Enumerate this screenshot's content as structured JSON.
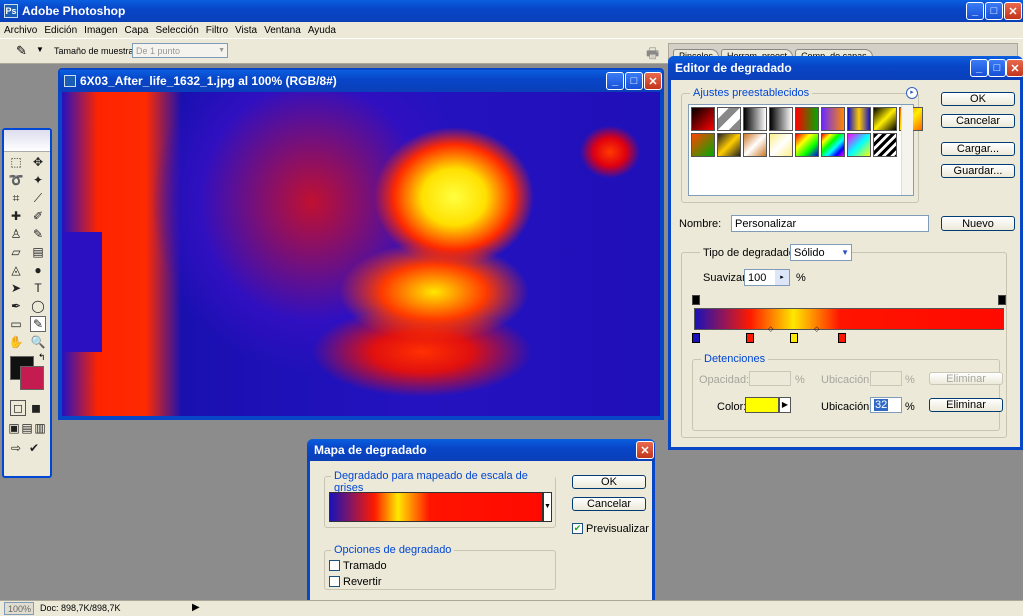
{
  "app": {
    "title": "Adobe Photoshop"
  },
  "menu": [
    "Archivo",
    "Edición",
    "Imagen",
    "Capa",
    "Selección",
    "Filtro",
    "Vista",
    "Ventana",
    "Ayuda"
  ],
  "options_bar": {
    "sample_label": "Tamaño de muestra:",
    "sample_value": "De 1 punto"
  },
  "palette_tabs": [
    "Pinceles",
    "Herram. preest",
    "Comp. de capas"
  ],
  "document": {
    "title": "6X03_After_life_1632_1.jpg al 100% (RGB/8#)"
  },
  "gradient_editor": {
    "title": "Editor de degradado",
    "presets_label": "Ajustes preestablecidos",
    "ok": "OK",
    "cancel": "Cancelar",
    "load": "Cargar...",
    "save": "Guardar...",
    "name_label": "Nombre:",
    "name_value": "Personalizar",
    "new": "Nuevo",
    "type_label": "Tipo de degradado:",
    "type_value": "Sólido",
    "smooth_label": "Suavizar:",
    "smooth_value": "100",
    "percent": "%",
    "stops_label": "Detenciones",
    "opacity_label": "Opacidad:",
    "location_label": "Ubicación:",
    "delete": "Eliminar",
    "color_label": "Color:",
    "location2_label": "Ubicación:",
    "location2_value": "32",
    "delete2": "Eliminar",
    "preset_swatches": [
      "linear-gradient(135deg,#000,#ff0000)",
      "linear-gradient(135deg,#fff 25%,#888 25%,#888 50%,#fff 50%,#fff 75%,#888 75%)",
      "linear-gradient(90deg,#000,#fff)",
      "linear-gradient(90deg,#000,#fff)",
      "linear-gradient(90deg,#ff0000,#00aa00)",
      "linear-gradient(90deg,#6a2cff,#ff8800)",
      "linear-gradient(90deg,#1111cc,#ffcc00,#1111cc)",
      "linear-gradient(135deg,#000,#ffee00,#000)",
      "linear-gradient(135deg,#ff6600,#ffee00,#ff6600)",
      "linear-gradient(135deg,#ff4400,#00aa00)",
      "linear-gradient(135deg,#222,#ffcc00,#222)",
      "linear-gradient(135deg,#cc7722,#fff,#cc7722)",
      "linear-gradient(135deg,#ffee88,#fff,#ffee88)",
      "linear-gradient(135deg,#ff0000,#ffff00,#00ff00,#0000ff)",
      "linear-gradient(135deg,#ff0000,#ffff00,#00ff00,#00ffff,#0000ff,#ff00ff)",
      "linear-gradient(135deg,#ff00ff,#00ffff,#ffff00)",
      "repeating-linear-gradient(135deg,#000 0 3px,#fff 3px 6px)"
    ],
    "ramp_colors": [
      "#1a12b8",
      "#ff1a00",
      "#ffe800",
      "#ff1400",
      "#ff0a00"
    ]
  },
  "gradient_map": {
    "title": "Mapa de degradado",
    "group1": "Degradado para mapeado de escala de grises",
    "ok": "OK",
    "cancel": "Cancelar",
    "preview": "Previsualizar",
    "group2": "Opciones de degradado",
    "dither": "Tramado",
    "reverse": "Revertir"
  },
  "status": {
    "zoom": "100%",
    "doc": "Doc: 898,7K/898,7K"
  },
  "colors": {
    "fg": "#000000",
    "bg": "#c41c50"
  }
}
